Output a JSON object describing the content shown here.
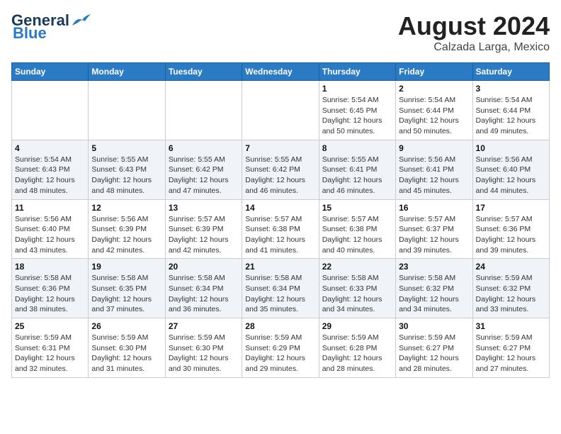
{
  "logo": {
    "line1": "General",
    "line2": "Blue"
  },
  "title": "August 2024",
  "subtitle": "Calzada Larga, Mexico",
  "weekdays": [
    "Sunday",
    "Monday",
    "Tuesday",
    "Wednesday",
    "Thursday",
    "Friday",
    "Saturday"
  ],
  "weeks": [
    [
      {
        "day": "",
        "info": ""
      },
      {
        "day": "",
        "info": ""
      },
      {
        "day": "",
        "info": ""
      },
      {
        "day": "",
        "info": ""
      },
      {
        "day": "1",
        "info": "Sunrise: 5:54 AM\nSunset: 6:45 PM\nDaylight: 12 hours\nand 50 minutes."
      },
      {
        "day": "2",
        "info": "Sunrise: 5:54 AM\nSunset: 6:44 PM\nDaylight: 12 hours\nand 50 minutes."
      },
      {
        "day": "3",
        "info": "Sunrise: 5:54 AM\nSunset: 6:44 PM\nDaylight: 12 hours\nand 49 minutes."
      }
    ],
    [
      {
        "day": "4",
        "info": "Sunrise: 5:54 AM\nSunset: 6:43 PM\nDaylight: 12 hours\nand 48 minutes."
      },
      {
        "day": "5",
        "info": "Sunrise: 5:55 AM\nSunset: 6:43 PM\nDaylight: 12 hours\nand 48 minutes."
      },
      {
        "day": "6",
        "info": "Sunrise: 5:55 AM\nSunset: 6:42 PM\nDaylight: 12 hours\nand 47 minutes."
      },
      {
        "day": "7",
        "info": "Sunrise: 5:55 AM\nSunset: 6:42 PM\nDaylight: 12 hours\nand 46 minutes."
      },
      {
        "day": "8",
        "info": "Sunrise: 5:55 AM\nSunset: 6:41 PM\nDaylight: 12 hours\nand 46 minutes."
      },
      {
        "day": "9",
        "info": "Sunrise: 5:56 AM\nSunset: 6:41 PM\nDaylight: 12 hours\nand 45 minutes."
      },
      {
        "day": "10",
        "info": "Sunrise: 5:56 AM\nSunset: 6:40 PM\nDaylight: 12 hours\nand 44 minutes."
      }
    ],
    [
      {
        "day": "11",
        "info": "Sunrise: 5:56 AM\nSunset: 6:40 PM\nDaylight: 12 hours\nand 43 minutes."
      },
      {
        "day": "12",
        "info": "Sunrise: 5:56 AM\nSunset: 6:39 PM\nDaylight: 12 hours\nand 42 minutes."
      },
      {
        "day": "13",
        "info": "Sunrise: 5:57 AM\nSunset: 6:39 PM\nDaylight: 12 hours\nand 42 minutes."
      },
      {
        "day": "14",
        "info": "Sunrise: 5:57 AM\nSunset: 6:38 PM\nDaylight: 12 hours\nand 41 minutes."
      },
      {
        "day": "15",
        "info": "Sunrise: 5:57 AM\nSunset: 6:38 PM\nDaylight: 12 hours\nand 40 minutes."
      },
      {
        "day": "16",
        "info": "Sunrise: 5:57 AM\nSunset: 6:37 PM\nDaylight: 12 hours\nand 39 minutes."
      },
      {
        "day": "17",
        "info": "Sunrise: 5:57 AM\nSunset: 6:36 PM\nDaylight: 12 hours\nand 39 minutes."
      }
    ],
    [
      {
        "day": "18",
        "info": "Sunrise: 5:58 AM\nSunset: 6:36 PM\nDaylight: 12 hours\nand 38 minutes."
      },
      {
        "day": "19",
        "info": "Sunrise: 5:58 AM\nSunset: 6:35 PM\nDaylight: 12 hours\nand 37 minutes."
      },
      {
        "day": "20",
        "info": "Sunrise: 5:58 AM\nSunset: 6:34 PM\nDaylight: 12 hours\nand 36 minutes."
      },
      {
        "day": "21",
        "info": "Sunrise: 5:58 AM\nSunset: 6:34 PM\nDaylight: 12 hours\nand 35 minutes."
      },
      {
        "day": "22",
        "info": "Sunrise: 5:58 AM\nSunset: 6:33 PM\nDaylight: 12 hours\nand 34 minutes."
      },
      {
        "day": "23",
        "info": "Sunrise: 5:58 AM\nSunset: 6:32 PM\nDaylight: 12 hours\nand 34 minutes."
      },
      {
        "day": "24",
        "info": "Sunrise: 5:59 AM\nSunset: 6:32 PM\nDaylight: 12 hours\nand 33 minutes."
      }
    ],
    [
      {
        "day": "25",
        "info": "Sunrise: 5:59 AM\nSunset: 6:31 PM\nDaylight: 12 hours\nand 32 minutes."
      },
      {
        "day": "26",
        "info": "Sunrise: 5:59 AM\nSunset: 6:30 PM\nDaylight: 12 hours\nand 31 minutes."
      },
      {
        "day": "27",
        "info": "Sunrise: 5:59 AM\nSunset: 6:30 PM\nDaylight: 12 hours\nand 30 minutes."
      },
      {
        "day": "28",
        "info": "Sunrise: 5:59 AM\nSunset: 6:29 PM\nDaylight: 12 hours\nand 29 minutes."
      },
      {
        "day": "29",
        "info": "Sunrise: 5:59 AM\nSunset: 6:28 PM\nDaylight: 12 hours\nand 28 minutes."
      },
      {
        "day": "30",
        "info": "Sunrise: 5:59 AM\nSunset: 6:27 PM\nDaylight: 12 hours\nand 28 minutes."
      },
      {
        "day": "31",
        "info": "Sunrise: 5:59 AM\nSunset: 6:27 PM\nDaylight: 12 hours\nand 27 minutes."
      }
    ]
  ]
}
